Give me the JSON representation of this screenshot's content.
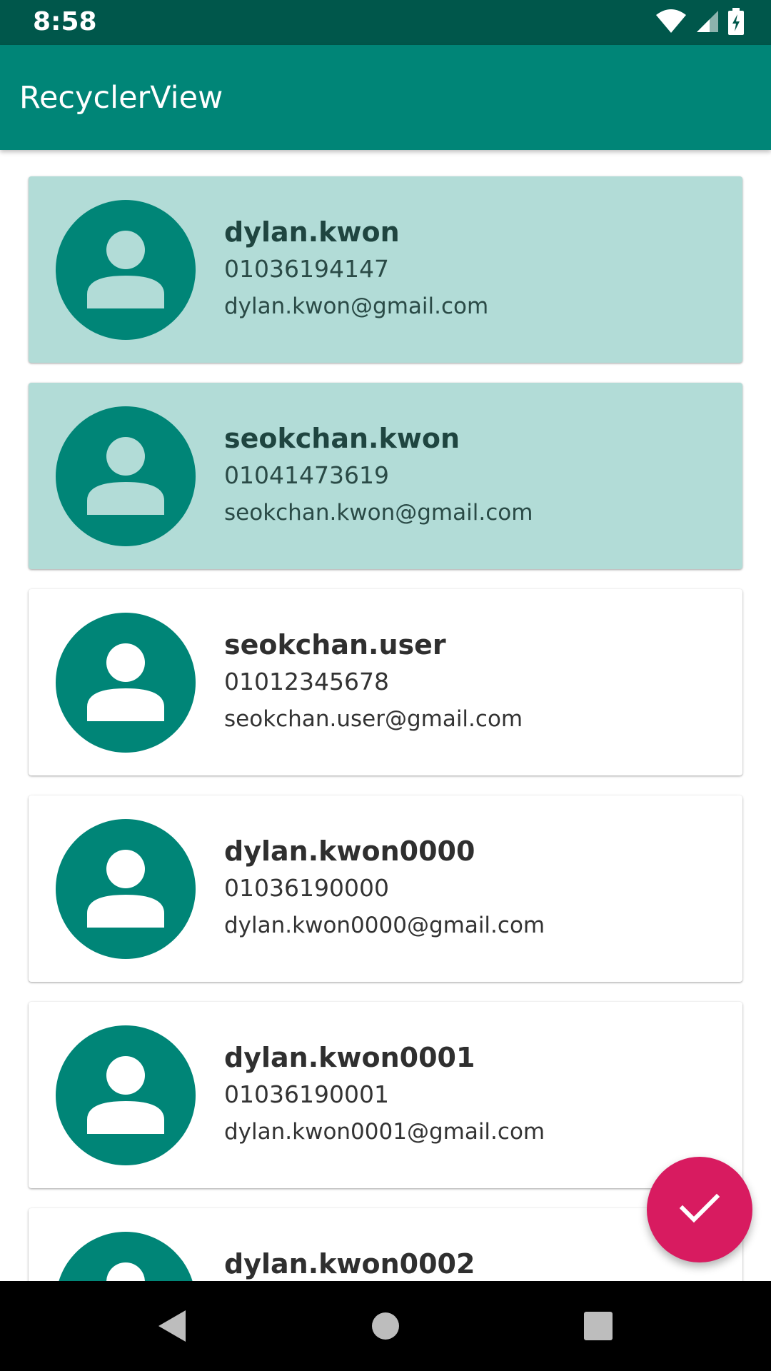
{
  "status_bar": {
    "time": "8:58",
    "icons": [
      "wifi-icon",
      "cellular-signal-icon",
      "battery-charging-icon"
    ]
  },
  "app_bar": {
    "title": "RecyclerView"
  },
  "colors": {
    "primary": "#008577",
    "primary_dark": "#00574b",
    "selected_card": "#b2dcd7",
    "accent": "#d81b60"
  },
  "contacts": [
    {
      "name": "dylan.kwon",
      "phone": "01036194147",
      "email": "dylan.kwon@gmail.com",
      "selected": true
    },
    {
      "name": "seokchan.kwon",
      "phone": "01041473619",
      "email": "seokchan.kwon@gmail.com",
      "selected": true
    },
    {
      "name": "seokchan.user",
      "phone": "01012345678",
      "email": "seokchan.user@gmail.com",
      "selected": false
    },
    {
      "name": "dylan.kwon0000",
      "phone": "01036190000",
      "email": "dylan.kwon0000@gmail.com",
      "selected": false
    },
    {
      "name": "dylan.kwon0001",
      "phone": "01036190001",
      "email": "dylan.kwon0001@gmail.com",
      "selected": false
    },
    {
      "name": "dylan.kwon0002",
      "phone": "",
      "email": "",
      "selected": false
    }
  ],
  "fab": {
    "icon": "check-icon"
  },
  "nav_bar": {
    "icons": [
      "back-icon",
      "home-icon",
      "recents-icon"
    ]
  }
}
